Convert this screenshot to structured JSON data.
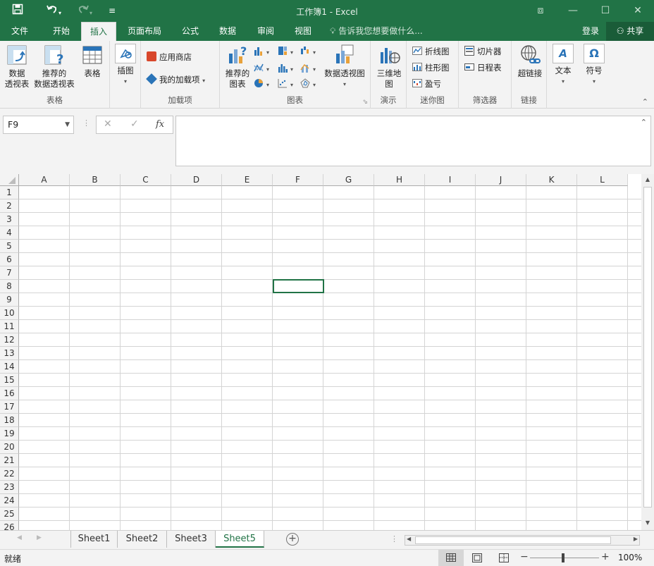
{
  "app": {
    "title": "工作簿1 - Excel"
  },
  "qat": {
    "save": "save-icon",
    "undo": "undo-icon",
    "redo": "redo-icon",
    "customize": "customize-icon"
  },
  "tabs": [
    "文件",
    "开始",
    "插入",
    "页面布局",
    "公式",
    "数据",
    "审阅",
    "视图"
  ],
  "active_tab": "插入",
  "tell_me": "告诉我您想要做什么...",
  "account": {
    "login": "登录",
    "share": "共享"
  },
  "ribbon": {
    "tables": {
      "label": "表格",
      "pivot": "数据\n透视表",
      "rec_pivot": "推荐的\n数据透视表",
      "table": "表格"
    },
    "illus": {
      "label": "插图"
    },
    "addins": {
      "label": "加载项",
      "store": "应用商店",
      "my": "我的加载项"
    },
    "charts": {
      "label": "图表",
      "rec": "推荐的\n图表",
      "pivotchart": "数据透视图"
    },
    "tours": {
      "label": "演示",
      "map3d": "三维地\n图"
    },
    "spark": {
      "label": "迷你图",
      "line": "折线图",
      "column": "柱形图",
      "winloss": "盈亏"
    },
    "filters": {
      "label": "筛选器",
      "slicer": "切片器",
      "timeline": "日程表"
    },
    "links": {
      "label": "链接",
      "hyperlink": "超链接"
    },
    "text": {
      "label": "文本"
    },
    "symbols": {
      "label": "符号"
    }
  },
  "namebox": "F9",
  "fx": "fx",
  "columns": [
    "A",
    "B",
    "C",
    "D",
    "E",
    "F",
    "G",
    "H",
    "I",
    "J",
    "K",
    "L"
  ],
  "rows": [
    "1",
    "2",
    "3",
    "4",
    "5",
    "6",
    "7",
    "8",
    "9",
    "10",
    "11",
    "12",
    "13",
    "14",
    "15",
    "16",
    "17",
    "18",
    "19",
    "20",
    "21",
    "22",
    "23",
    "24",
    "25",
    "26"
  ],
  "sheets": [
    "Sheet1",
    "Sheet2",
    "Sheet3",
    "Sheet5"
  ],
  "active_sheet": "Sheet5",
  "status": {
    "ready": "就绪",
    "zoom": "100%"
  },
  "colors": {
    "brand": "#217346"
  }
}
